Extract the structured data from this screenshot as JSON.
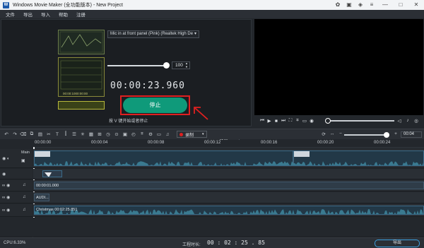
{
  "window": {
    "title": "Windows Movie Maker (全功能版本) - New Project",
    "app_icon": "app-logo-icon"
  },
  "titlebar_icons": [
    "palette-icon",
    "gift-icon",
    "bag-icon",
    "menu-icon",
    "minimize-icon",
    "maximize-icon",
    "close-icon"
  ],
  "menu": [
    "文件",
    "导出",
    "导入",
    "帮助",
    "注册"
  ],
  "record_panel": {
    "mic_device": "Mic in at front panel (Pink) (Realtek High De",
    "volume_value": "100",
    "volume_level": 1.0,
    "timer": "00:00:23.960",
    "stop_label": "停止",
    "hint": "按 V 键开始或者停止",
    "back_label": "返回",
    "thumbnail_timecode": "00:00:1000:00:00"
  },
  "player": {
    "controls": [
      "prev-frame-icon",
      "play-icon",
      "stop-icon",
      "next-frame-icon",
      "fullscreen-icon",
      "crop-icon",
      "speaker-icon",
      "record-camera-icon"
    ],
    "position": 0.0
  },
  "toolbar": {
    "tools": [
      "undo-icon",
      "redo-icon",
      "delete-icon",
      "copy-icon",
      "paste-icon",
      "text-icon",
      "split-icon",
      "voice-icon",
      "effects-icon",
      "mosaic-icon",
      "freeze-icon",
      "speed-icon",
      "zoom-icon",
      "pip-icon",
      "duration-icon",
      "crop-icon",
      "tools-icon",
      "screen-icon",
      "audio-icon"
    ],
    "record_label": "录制",
    "zoom_value": "00:04",
    "zoom_level": 0.95
  },
  "timeline": {
    "ruler_ticks": [
      "00:00:00",
      "00:00:04",
      "00:00:08",
      "00:00:12",
      "00:00:16",
      "00:00:20",
      "00:00:24"
    ],
    "main_label": "Main",
    "tracks": [
      {
        "name": "video-track",
        "clip_label": ""
      },
      {
        "name": "overlay-track",
        "clip_label": ""
      },
      {
        "name": "audio-track-1",
        "clip_label": "00:00:01.000"
      },
      {
        "name": "audio-track-2",
        "clip_label": "AUDI..."
      },
      {
        "name": "music-track",
        "clip_label": "Christmas  00:02:25.851"
      }
    ]
  },
  "status": {
    "cpu": "CPU:6.33%",
    "project_time_label": "工程时长:",
    "project_time": "00 : 02 : 25 . 85",
    "export_label": "导出"
  },
  "colors": {
    "accent": "#0f9a7a",
    "highlight": "#e02020",
    "clip": "#2d4a5e"
  }
}
